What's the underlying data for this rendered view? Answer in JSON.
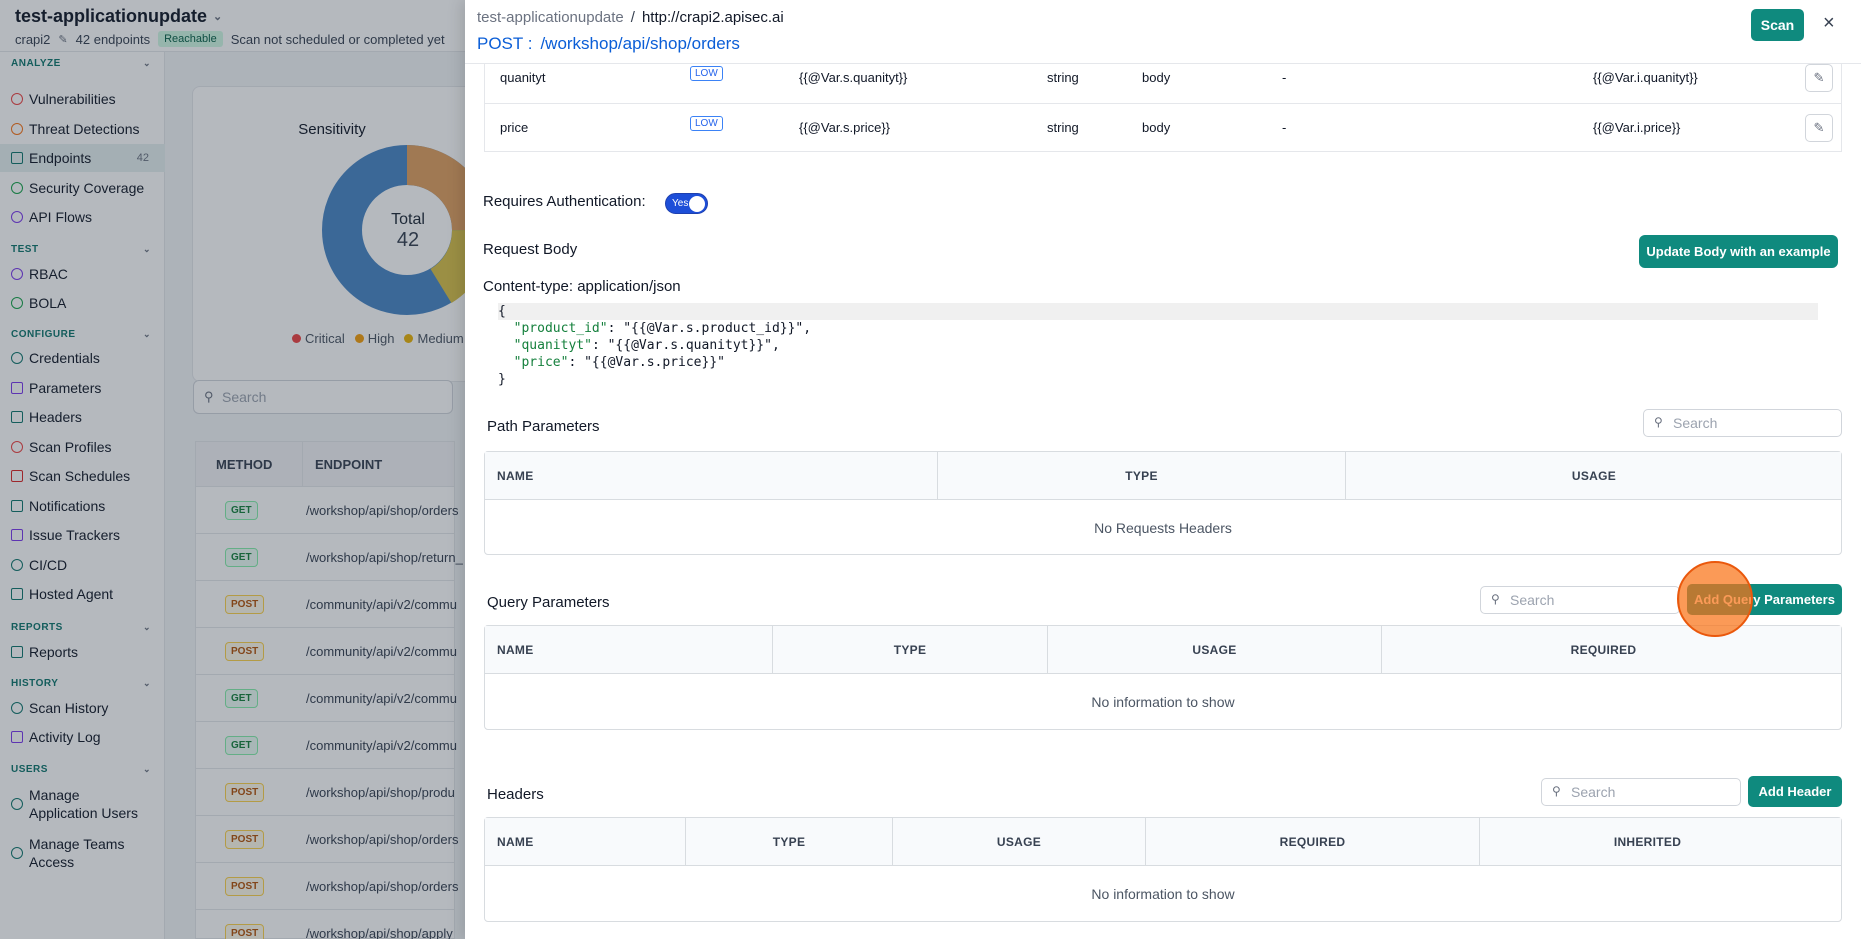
{
  "app": {
    "title": "test-applicationupdate",
    "project": "crapi2",
    "endpoints_count": "42 endpoints",
    "reach_badge": "Reachable",
    "scan_status": "Scan not scheduled or completed yet"
  },
  "sidebar": {
    "sections": [
      {
        "label": "ANALYZE"
      },
      {
        "label": "TEST"
      },
      {
        "label": "CONFIGURE"
      },
      {
        "label": "REPORTS"
      },
      {
        "label": "HISTORY"
      },
      {
        "label": "USERS"
      }
    ],
    "items": [
      {
        "label": "Vulnerabilities",
        "icon": "shield-icon"
      },
      {
        "label": "Threat Detections",
        "icon": "alert-icon"
      },
      {
        "label": "Endpoints",
        "icon": "endpoints-icon",
        "count": "42"
      },
      {
        "label": "Security Coverage",
        "icon": "coverage-icon"
      },
      {
        "label": "API Flows",
        "icon": "flow-icon"
      },
      {
        "label": "RBAC",
        "icon": "rbac-icon"
      },
      {
        "label": "BOLA",
        "icon": "bola-icon"
      },
      {
        "label": "Credentials",
        "icon": "key-icon"
      },
      {
        "label": "Parameters",
        "icon": "braces-icon"
      },
      {
        "label": "Headers",
        "icon": "headers-icon"
      },
      {
        "label": "Scan Profiles",
        "icon": "profile-icon"
      },
      {
        "label": "Scan Schedules",
        "icon": "calendar-icon"
      },
      {
        "label": "Notifications",
        "icon": "bell-icon"
      },
      {
        "label": "Issue Trackers",
        "icon": "tracker-icon"
      },
      {
        "label": "CI/CD",
        "icon": "cicd-icon"
      },
      {
        "label": "Hosted Agent",
        "icon": "agent-icon"
      },
      {
        "label": "Reports",
        "icon": "report-icon"
      },
      {
        "label": "Scan History",
        "icon": "history-icon"
      },
      {
        "label": "Activity Log",
        "icon": "log-icon"
      },
      {
        "label": "Manage Application Users",
        "icon": "users-icon"
      },
      {
        "label": "Manage Teams Access",
        "icon": "teams-icon"
      }
    ]
  },
  "sensitivity_card": {
    "title": "Sensitivity",
    "total_label": "Total",
    "total_value": "42",
    "legend": [
      {
        "label": "Critical",
        "color": "#ef4444"
      },
      {
        "label": "High",
        "color": "#f59e0b"
      },
      {
        "label": "Medium",
        "color": "#eab308"
      }
    ]
  },
  "endpoints_table": {
    "search_placeholder": "Search",
    "headers": [
      "METHOD",
      "ENDPOINT"
    ],
    "rows": [
      {
        "method": "GET",
        "path": "/workshop/api/shop/orders"
      },
      {
        "method": "GET",
        "path": "/workshop/api/shop/return_"
      },
      {
        "method": "POST",
        "path": "/community/api/v2/commu"
      },
      {
        "method": "POST",
        "path": "/community/api/v2/commu"
      },
      {
        "method": "GET",
        "path": "/community/api/v2/commu"
      },
      {
        "method": "GET",
        "path": "/community/api/v2/commu"
      },
      {
        "method": "POST",
        "path": "/workshop/api/shop/produ"
      },
      {
        "method": "POST",
        "path": "/workshop/api/shop/orders"
      },
      {
        "method": "POST",
        "path": "/workshop/api/shop/orders"
      },
      {
        "method": "POST",
        "path": "/workshop/api/shop/apply"
      }
    ]
  },
  "drawer": {
    "breadcrumb_app": "test-applicationupdate",
    "breadcrumb_sep": "/",
    "breadcrumb_host": "http://crapi2.apisec.ai",
    "method": "POST :",
    "path": "/workshop/api/shop/orders",
    "scan_label": "Scan",
    "close_icon": "×",
    "body_params": [
      {
        "name": "quanityt",
        "sensitivity": "LOW",
        "value": "{{@Var.s.quanityt}}",
        "type": "string",
        "location": "body",
        "dash": "-",
        "alt_value": "{{@Var.i.quanityt}}"
      },
      {
        "name": "price",
        "sensitivity": "LOW",
        "value": "{{@Var.s.price}}",
        "type": "string",
        "location": "body",
        "dash": "-",
        "alt_value": "{{@Var.i.price}}"
      }
    ],
    "auth_label": "Requires Authentication:",
    "auth_toggle": "Yes",
    "request_body_title": "Request Body",
    "update_body_label": "Update Body with an example",
    "content_type": "Content-type: application/json",
    "code_lines": [
      {
        "pre": "{",
        "k": "",
        "post": ""
      },
      {
        "pre": "  ",
        "k": "\"product_id\"",
        "post": ": \"{{@Var.s.product_id}}\","
      },
      {
        "pre": "  ",
        "k": "\"quanityt\"",
        "post": ": \"{{@Var.s.quanityt}}\","
      },
      {
        "pre": "  ",
        "k": "\"price\"",
        "post": ": \"{{@Var.s.price}}\""
      },
      {
        "pre": "}",
        "k": "",
        "post": ""
      }
    ],
    "path_params": {
      "title": "Path Parameters",
      "search_placeholder": "Search",
      "headers": [
        "NAME",
        "TYPE",
        "USAGE"
      ],
      "empty": "No Requests Headers"
    },
    "query_params": {
      "title": "Query Parameters",
      "search_placeholder": "Search",
      "add_label": "Add Query Parameters",
      "headers": [
        "NAME",
        "TYPE",
        "USAGE",
        "REQUIRED"
      ],
      "empty": "No information to show"
    },
    "headers_section": {
      "title": "Headers",
      "search_placeholder": "Search",
      "add_label": "Add Header",
      "headers": [
        "NAME",
        "TYPE",
        "USAGE",
        "REQUIRED",
        "INHERITED"
      ],
      "empty": "No information to show"
    }
  }
}
